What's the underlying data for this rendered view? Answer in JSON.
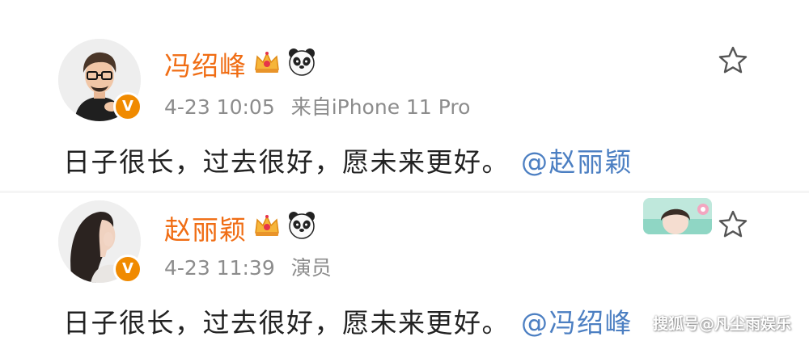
{
  "posts": [
    {
      "username": "冯绍峰",
      "timestamp": "4-23 10:05",
      "source": "来自iPhone 11 Pro",
      "text": "日子很长，过去很好，愿未来更好。",
      "mention": "@赵丽颖",
      "badges": [
        "crown-icon",
        "panda-icon"
      ],
      "verified_icon": "verified-v-icon"
    },
    {
      "username": "赵丽颖",
      "timestamp": "4-23 11:39",
      "source": "演员",
      "text": "日子很长，过去很好，愿未来更好。",
      "mention": "@冯绍峰",
      "badges": [
        "crown-icon",
        "panda-icon"
      ],
      "verified_icon": "verified-v-icon"
    }
  ],
  "watermark": "搜狐号@凡尘雨娱乐",
  "colors": {
    "username": "#f06d14",
    "mention": "#4c7fc2",
    "meta": "#8c8c8c",
    "text": "#222222",
    "verified": "#f08a00"
  }
}
